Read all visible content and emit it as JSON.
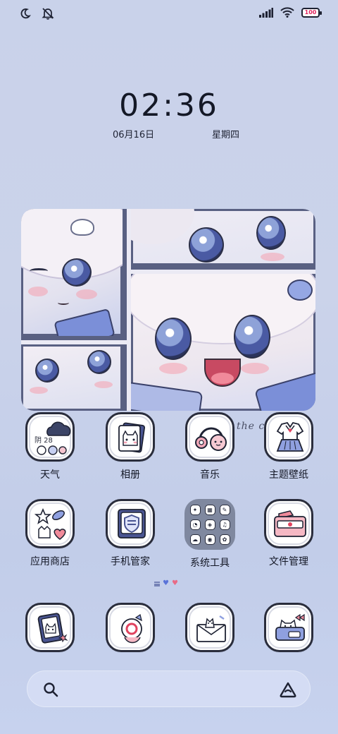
{
  "status_bar": {
    "left_icons": [
      "moon-icon",
      "mute-icon"
    ],
    "right_icons": [
      "signal-icon",
      "wifi-icon",
      "battery-icon"
    ],
    "battery_level": "100",
    "colors": {
      "foreground": "#1e2233",
      "battery_text": "#e0245e"
    }
  },
  "clock": {
    "time": "02:36",
    "date": "06月16日",
    "weekday": "星期四"
  },
  "widget": {
    "caption": "the c"
  },
  "apps_row1": [
    {
      "label": "天气",
      "icon": "weather-icon",
      "badge": "阴 28"
    },
    {
      "label": "相册",
      "icon": "gallery-icon"
    },
    {
      "label": "音乐",
      "icon": "music-icon"
    },
    {
      "label": "主题壁纸",
      "icon": "themes-icon"
    }
  ],
  "apps_row2": [
    {
      "label": "应用商店",
      "icon": "app-store-icon"
    },
    {
      "label": "手机管家",
      "icon": "security-icon"
    },
    {
      "label": "系统工具",
      "icon": "system-tools-folder-icon"
    },
    {
      "label": "文件管理",
      "icon": "file-manager-icon"
    }
  ],
  "dock": [
    {
      "icon": "phone-icon"
    },
    {
      "icon": "messages-icon"
    },
    {
      "icon": "mail-icon"
    },
    {
      "icon": "camera-icon"
    }
  ],
  "page_indicator": {
    "pages": 3,
    "current": 2
  },
  "search": {
    "left_icon": "search-icon",
    "right_icon": "assistant-icon"
  },
  "colors": {
    "background": "#c9d2ea",
    "icon_border": "#2a2d3c",
    "accent_blue": "#7b8fd8",
    "accent_pink": "#f08a9a"
  }
}
